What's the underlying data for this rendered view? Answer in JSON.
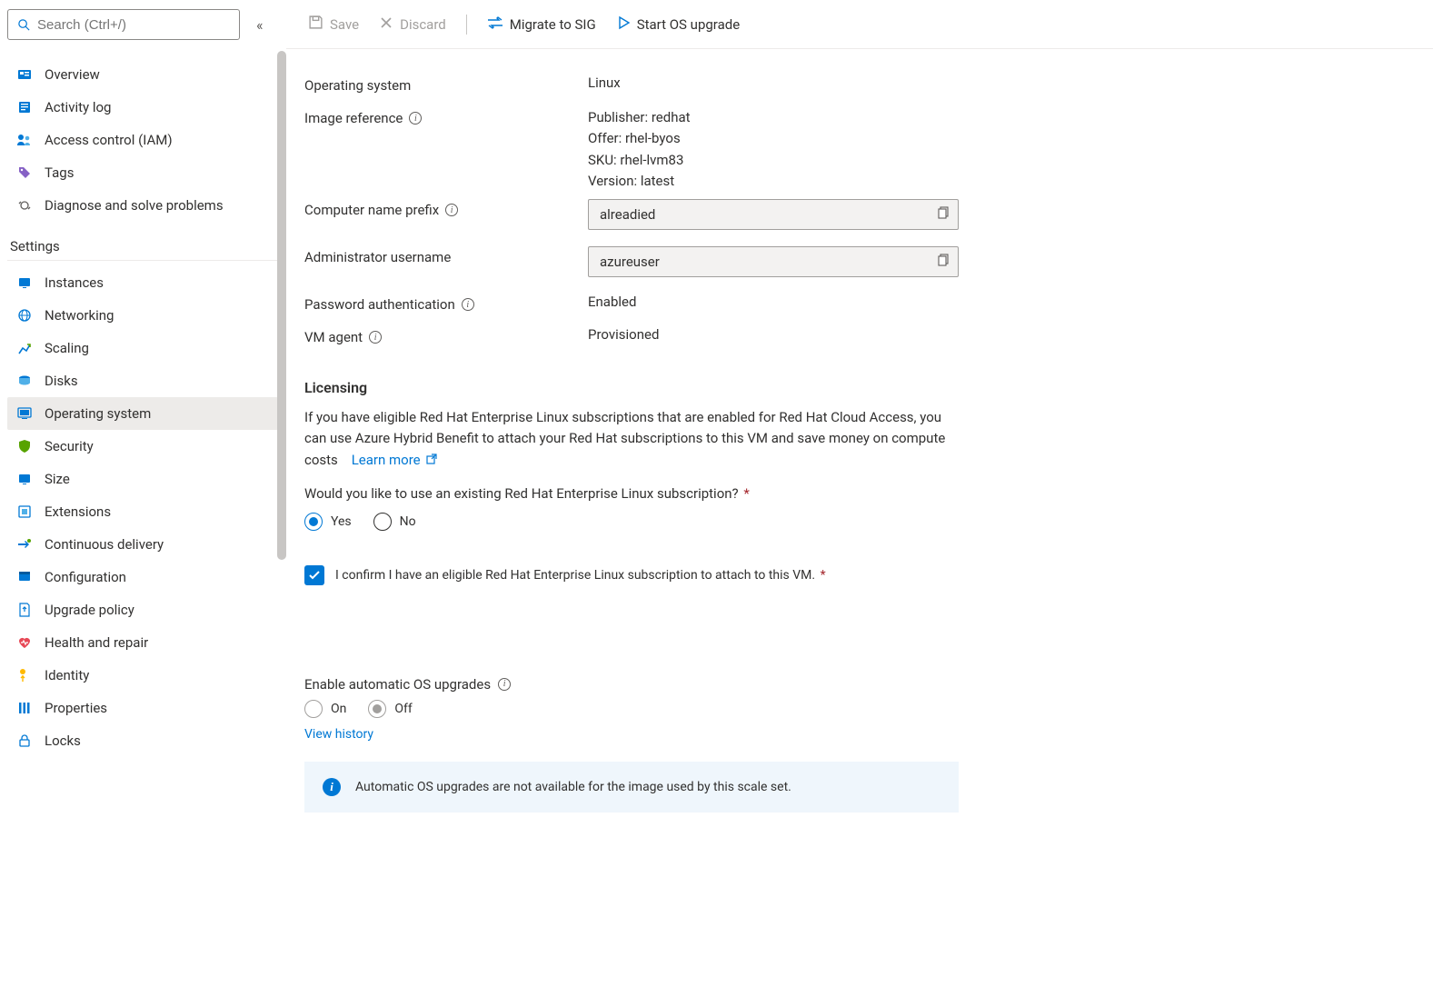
{
  "search": {
    "placeholder": "Search (Ctrl+/)"
  },
  "nav": {
    "top": [
      {
        "label": "Overview"
      },
      {
        "label": "Activity log"
      },
      {
        "label": "Access control (IAM)"
      },
      {
        "label": "Tags"
      },
      {
        "label": "Diagnose and solve problems"
      }
    ],
    "settings_header": "Settings",
    "settings": [
      {
        "label": "Instances"
      },
      {
        "label": "Networking"
      },
      {
        "label": "Scaling"
      },
      {
        "label": "Disks"
      },
      {
        "label": "Operating system"
      },
      {
        "label": "Security"
      },
      {
        "label": "Size"
      },
      {
        "label": "Extensions"
      },
      {
        "label": "Continuous delivery"
      },
      {
        "label": "Configuration"
      },
      {
        "label": "Upgrade policy"
      },
      {
        "label": "Health and repair"
      },
      {
        "label": "Identity"
      },
      {
        "label": "Properties"
      },
      {
        "label": "Locks"
      }
    ]
  },
  "toolbar": {
    "save": "Save",
    "discard": "Discard",
    "migrate": "Migrate to SIG",
    "start_upgrade": "Start OS upgrade"
  },
  "fields": {
    "os_label": "Operating system",
    "os_value": "Linux",
    "image_ref_label": "Image reference",
    "image_ref_publisher": "Publisher: redhat",
    "image_ref_offer": "Offer: rhel-byos",
    "image_ref_sku": "SKU: rhel-lvm83",
    "image_ref_version": "Version: latest",
    "computer_prefix_label": "Computer name prefix",
    "computer_prefix_value": "alreadied",
    "admin_user_label": "Administrator username",
    "admin_user_value": "azureuser",
    "pw_auth_label": "Password authentication",
    "pw_auth_value": "Enabled",
    "vm_agent_label": "VM agent",
    "vm_agent_value": "Provisioned"
  },
  "licensing": {
    "title": "Licensing",
    "body": "If you have eligible Red Hat Enterprise Linux subscriptions that are enabled for Red Hat Cloud Access, you can use Azure Hybrid Benefit to attach your Red Hat subscriptions to this VM and save money on compute costs",
    "learn_more": "Learn more",
    "question": "Would you like to use an existing Red Hat Enterprise Linux subscription?",
    "yes": "Yes",
    "no": "No",
    "confirm": "I confirm I have an eligible Red Hat Enterprise Linux subscription to attach to this VM."
  },
  "os_upgrades": {
    "label": "Enable automatic OS upgrades",
    "on": "On",
    "off": "Off",
    "view_history": "View history",
    "banner": "Automatic OS upgrades are not available for the image used by this scale set."
  }
}
